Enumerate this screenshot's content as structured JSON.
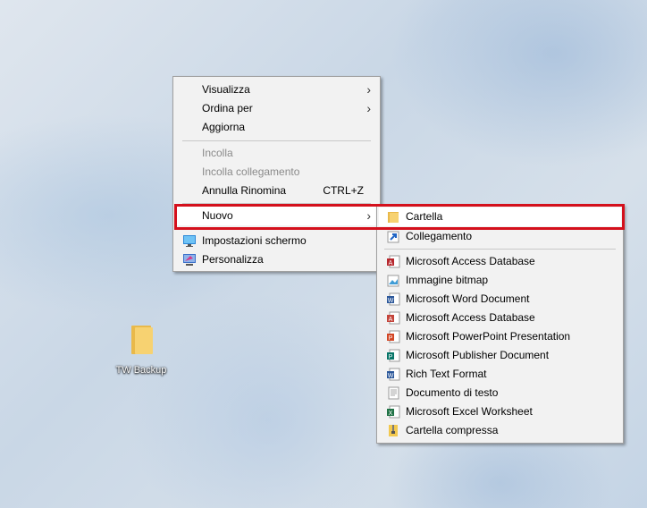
{
  "desktop": {
    "folder_label": "TW Backup"
  },
  "context_menu": {
    "items": [
      {
        "label": "Visualizza"
      },
      {
        "label": "Ordina per"
      },
      {
        "label": "Aggiorna"
      },
      {
        "label": "Incolla"
      },
      {
        "label": "Incolla collegamento"
      },
      {
        "label": "Annulla Rinomina",
        "shortcut": "CTRL+Z"
      },
      {
        "label": "Nuovo"
      },
      {
        "label": "Impostazioni schermo"
      },
      {
        "label": "Personalizza"
      }
    ],
    "submenu_arrow": "›"
  },
  "new_submenu": {
    "items": [
      {
        "label": "Cartella"
      },
      {
        "label": "Collegamento"
      },
      {
        "label": "Microsoft Access Database"
      },
      {
        "label": "Immagine bitmap"
      },
      {
        "label": "Microsoft Word Document"
      },
      {
        "label": "Microsoft Access Database"
      },
      {
        "label": "Microsoft PowerPoint Presentation"
      },
      {
        "label": "Microsoft Publisher Document"
      },
      {
        "label": "Rich Text Format"
      },
      {
        "label": "Documento di testo"
      },
      {
        "label": "Microsoft Excel Worksheet"
      },
      {
        "label": "Cartella compressa"
      }
    ]
  },
  "colors": {
    "highlight_border": "#d4101c",
    "menu_bg": "#f2f2f2"
  }
}
